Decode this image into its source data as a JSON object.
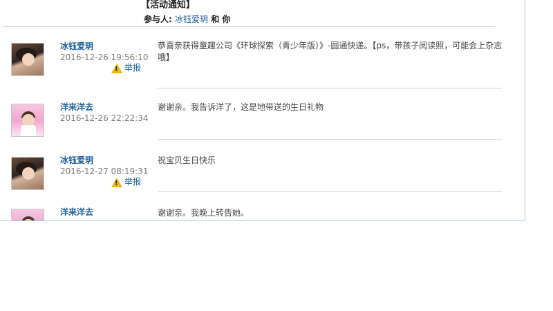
{
  "header": {
    "title": "【活动通知】",
    "participants_prefix": "参与人:",
    "participant_user": "冰钰爱玥",
    "participants_suffix": "和 你"
  },
  "messages": [
    {
      "user": "冰钰爱玥",
      "time": "2016-12-26 19:56:10",
      "report_label": "举报",
      "text": "恭喜亲获得童趣公司《环球探索（青少年版）》-圆通快递。【ps，带孩子阅读照，可能会上杂志哦】"
    },
    {
      "user": "洋来洋去",
      "time": "2016-12-26 22:22:34",
      "text": "谢谢亲。我告诉洋了，这是地带送的生日礼物"
    },
    {
      "user": "冰钰爱玥",
      "time": "2016-12-27 08:19:31",
      "report_label": "举报",
      "text": "祝宝贝生日快乐"
    },
    {
      "user": "洋来洋去",
      "time": "",
      "text": "谢谢亲。我晚上转告她。"
    }
  ],
  "icons": {
    "report": "warning-icon"
  },
  "colors": {
    "link": "#1d5b98",
    "border": "#aacfe6",
    "warning": "#f2b705"
  }
}
